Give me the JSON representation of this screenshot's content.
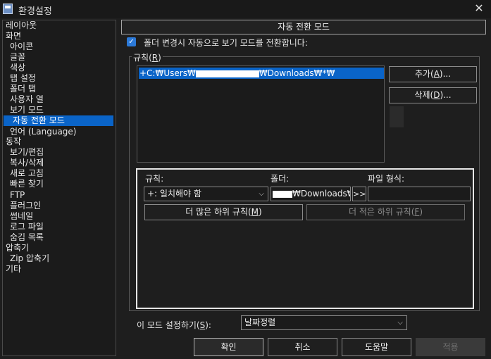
{
  "window": {
    "title": "환경설정",
    "close_icon": "close-icon"
  },
  "tree": {
    "items": [
      {
        "label": "레이아웃"
      },
      {
        "label": "화면"
      },
      {
        "label": "아이콘"
      },
      {
        "label": "글꼴"
      },
      {
        "label": "색상"
      },
      {
        "label": "탭 설정"
      },
      {
        "label": "폴더 탭"
      },
      {
        "label": "사용자 열"
      },
      {
        "label": "보기 모드"
      },
      {
        "label": "자동 전환 모드",
        "selected": true
      },
      {
        "label": "언어 (Language)"
      },
      {
        "label": "동작"
      },
      {
        "label": "보기/편집"
      },
      {
        "label": "복사/삭제"
      },
      {
        "label": "새로 고침"
      },
      {
        "label": "빠른 찾기"
      },
      {
        "label": "FTP"
      },
      {
        "label": "플러그인"
      },
      {
        "label": "썸네일"
      },
      {
        "label": "로그 파일"
      },
      {
        "label": "숨김 목록"
      },
      {
        "label": "압축기"
      },
      {
        "label": "Zip 압축기"
      },
      {
        "label": "기타"
      }
    ]
  },
  "main": {
    "header": "자동 전환 모드",
    "auto_switch_checkbox": {
      "label": "폴더 변경시 자동으로 보기 모드를 전환합니다:",
      "checked": true
    },
    "rules_group": {
      "label_text": "규칙(",
      "label_key": "R",
      "label_end": ")",
      "list": [
        {
          "text_pre": "+C:₩Users₩",
          "text_post": "₩Downloads₩*₩"
        }
      ],
      "add_button": {
        "pre": "추가(",
        "key": "A",
        "post": ")..."
      },
      "delete_button": {
        "pre": "삭제(",
        "key": "D",
        "post": ")..."
      }
    },
    "rule_editor": {
      "rule_label": "규칙:",
      "folder_label": "폴더:",
      "filetype_label": "파일 형식:",
      "rule_select": "+: 일치해야 함",
      "folder_value": "₩Downloads₩*",
      "arrow_button": ">>",
      "filetype_value": "",
      "more_button": {
        "pre": "더 많은 하위 규칙(",
        "key": "M",
        "post": ")"
      },
      "fewer_button": {
        "pre": "더 적은 하위 규칙(",
        "key": "F",
        "post": ")"
      }
    },
    "mode_setting": {
      "label_pre": "이 모드 설정하기(",
      "label_key": "S",
      "label_post": "):",
      "value": "날짜정렬"
    }
  },
  "footer": {
    "ok": "확인",
    "cancel": "취소",
    "help": "도움말",
    "apply": "적용"
  },
  "colors": {
    "selection": "#0a64c8",
    "background": "#1e1e1e",
    "checkbox": "#2b79d8"
  }
}
